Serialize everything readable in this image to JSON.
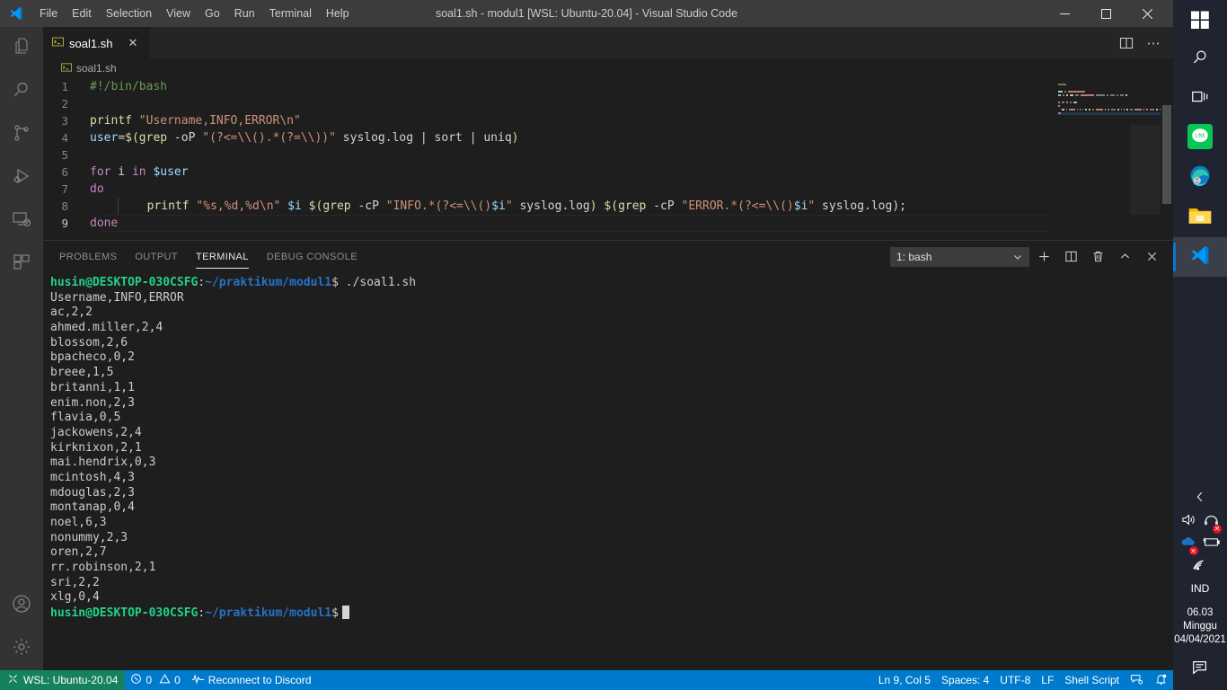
{
  "window": {
    "title": "soal1.sh - modul1 [WSL: Ubuntu-20.04] - Visual Studio Code",
    "minimize_label": "─",
    "maximize_label": "❐",
    "close_label": "✕"
  },
  "menu": {
    "items": [
      "File",
      "Edit",
      "Selection",
      "View",
      "Go",
      "Run",
      "Terminal",
      "Help"
    ]
  },
  "activitybar": {
    "items": [
      {
        "name": "explorer",
        "icon": "files-icon"
      },
      {
        "name": "search",
        "icon": "search-icon"
      },
      {
        "name": "source-control",
        "icon": "source-control-icon"
      },
      {
        "name": "run-debug",
        "icon": "run-debug-icon"
      },
      {
        "name": "remote-explorer",
        "icon": "remote-explorer-icon"
      },
      {
        "name": "extensions",
        "icon": "extensions-icon"
      }
    ],
    "bottom": [
      {
        "name": "accounts",
        "icon": "account-icon"
      },
      {
        "name": "settings",
        "icon": "gear-icon"
      }
    ]
  },
  "editor": {
    "tab": {
      "label": "soal1.sh",
      "close": "✕",
      "icon": "terminal-file-icon"
    },
    "actions": {
      "split": "split-editor-icon",
      "more": "⋯"
    },
    "breadcrumb": "soal1.sh",
    "lines": [
      {
        "n": "1",
        "tokens": [
          {
            "t": "comment",
            "v": "#!/bin/bash"
          }
        ]
      },
      {
        "n": "2",
        "tokens": []
      },
      {
        "n": "3",
        "tokens": [
          {
            "t": "fn",
            "v": "printf"
          },
          {
            "t": "plain",
            "v": " "
          },
          {
            "t": "str",
            "v": "\"Username,INFO,ERROR\\n\""
          }
        ]
      },
      {
        "n": "4",
        "tokens": [
          {
            "t": "var",
            "v": "user"
          },
          {
            "t": "op",
            "v": "="
          },
          {
            "t": "fn",
            "v": "$("
          },
          {
            "t": "fn",
            "v": "grep"
          },
          {
            "t": "plain",
            "v": " -oP "
          },
          {
            "t": "str",
            "v": "\"(?<=\\\\().*(?=\\\\))\""
          },
          {
            "t": "plain",
            "v": " syslog.log "
          },
          {
            "t": "op",
            "v": "|"
          },
          {
            "t": "plain",
            "v": " sort "
          },
          {
            "t": "op",
            "v": "|"
          },
          {
            "t": "plain",
            "v": " uniq"
          },
          {
            "t": "fn",
            "v": ")"
          }
        ]
      },
      {
        "n": "5",
        "tokens": []
      },
      {
        "n": "6",
        "tokens": [
          {
            "t": "kw",
            "v": "for"
          },
          {
            "t": "plain",
            "v": " i "
          },
          {
            "t": "kw",
            "v": "in"
          },
          {
            "t": "plain",
            "v": " "
          },
          {
            "t": "var",
            "v": "$user"
          }
        ]
      },
      {
        "n": "7",
        "tokens": [
          {
            "t": "kw",
            "v": "do"
          }
        ]
      },
      {
        "n": "8",
        "tokens": [
          {
            "t": "indent",
            "v": "    "
          },
          {
            "t": "fn",
            "v": "printf"
          },
          {
            "t": "plain",
            "v": " "
          },
          {
            "t": "str",
            "v": "\"%s,%d,%d\\n\""
          },
          {
            "t": "plain",
            "v": " "
          },
          {
            "t": "var",
            "v": "$i"
          },
          {
            "t": "plain",
            "v": " "
          },
          {
            "t": "fn",
            "v": "$("
          },
          {
            "t": "fn",
            "v": "grep"
          },
          {
            "t": "plain",
            "v": " -cP "
          },
          {
            "t": "str",
            "v": "\"INFO.*(?<=\\\\()"
          },
          {
            "t": "var",
            "v": "$i"
          },
          {
            "t": "str",
            "v": "\""
          },
          {
            "t": "plain",
            "v": " syslog.log"
          },
          {
            "t": "fn",
            "v": ")"
          },
          {
            "t": "plain",
            "v": " "
          },
          {
            "t": "fn",
            "v": "$("
          },
          {
            "t": "fn",
            "v": "grep"
          },
          {
            "t": "plain",
            "v": " -cP "
          },
          {
            "t": "str",
            "v": "\"ERROR.*(?<=\\\\()"
          },
          {
            "t": "var",
            "v": "$i"
          },
          {
            "t": "str",
            "v": "\""
          },
          {
            "t": "plain",
            "v": " syslog.log"
          },
          {
            "t": "fn",
            "v": ")"
          },
          {
            "t": "op",
            "v": ";"
          }
        ]
      },
      {
        "n": "9",
        "tokens": [
          {
            "t": "kw",
            "v": "done"
          }
        ]
      }
    ],
    "current_line": 9
  },
  "panel": {
    "tabs": [
      {
        "label": "PROBLEMS",
        "active": false
      },
      {
        "label": "OUTPUT",
        "active": false
      },
      {
        "label": "TERMINAL",
        "active": true
      },
      {
        "label": "DEBUG CONSOLE",
        "active": false
      }
    ],
    "terminal_select": "1: bash",
    "buttons": [
      {
        "name": "new-terminal-button",
        "glyph": "+"
      },
      {
        "name": "split-terminal-button",
        "glyph": "split"
      },
      {
        "name": "kill-terminal-button",
        "glyph": "trash"
      },
      {
        "name": "maximize-panel-button",
        "glyph": "^"
      },
      {
        "name": "close-panel-button",
        "glyph": "✕"
      }
    ]
  },
  "terminal": {
    "prompt_user": "husin@DESKTOP-030CSFG",
    "prompt_path": "~/praktikum/modul1",
    "prompt_sym": "$",
    "command": "./soal1.sh",
    "output": [
      "Username,INFO,ERROR",
      "ac,2,2",
      "ahmed.miller,2,4",
      "blossom,2,6",
      "bpacheco,0,2",
      "breee,1,5",
      "britanni,1,1",
      "enim.non,2,3",
      "flavia,0,5",
      "jackowens,2,4",
      "kirknixon,2,1",
      "mai.hendrix,0,3",
      "mcintosh,4,3",
      "mdouglas,2,3",
      "montanap,0,4",
      "noel,6,3",
      "nonummy,2,3",
      "oren,2,7",
      "rr.robinson,2,1",
      "sri,2,2",
      "xlg,0,4"
    ]
  },
  "statusbar": {
    "remote": "WSL: Ubuntu-20.04",
    "errors": "0",
    "warnings": "0",
    "discord": "Reconnect to Discord",
    "position": "Ln 9, Col 5",
    "indent": "Spaces: 4",
    "encoding": "UTF-8",
    "eol": "LF",
    "language": "Shell Script",
    "feedback_icon": "feedback-icon",
    "bell_icon": "bell-dot-icon"
  },
  "taskbar": {
    "icons": [
      {
        "name": "start-button",
        "label": "start"
      },
      {
        "name": "taskbar-search",
        "label": "search"
      },
      {
        "name": "task-view",
        "label": "task-view"
      },
      {
        "name": "line-app",
        "label": "LINE"
      },
      {
        "name": "microsoft-edge",
        "label": "Edge"
      },
      {
        "name": "file-explorer",
        "label": "File Explorer"
      },
      {
        "name": "visual-studio-code",
        "label": "Visual Studio Code"
      }
    ],
    "tray": {
      "chevron": "‹",
      "language": "IND",
      "time": "06.03",
      "day": "Minggu",
      "date": "04/04/2021",
      "action_center": "action-center-icon"
    }
  },
  "colors": {
    "accent": "#007acc",
    "remote_green": "#16825d",
    "editor_bg": "#1e1e1e",
    "titlebar_bg": "#3c3c3c",
    "activitybar_bg": "#333333",
    "terminal_green": "#23d18b",
    "terminal_blue": "#2472c8"
  }
}
